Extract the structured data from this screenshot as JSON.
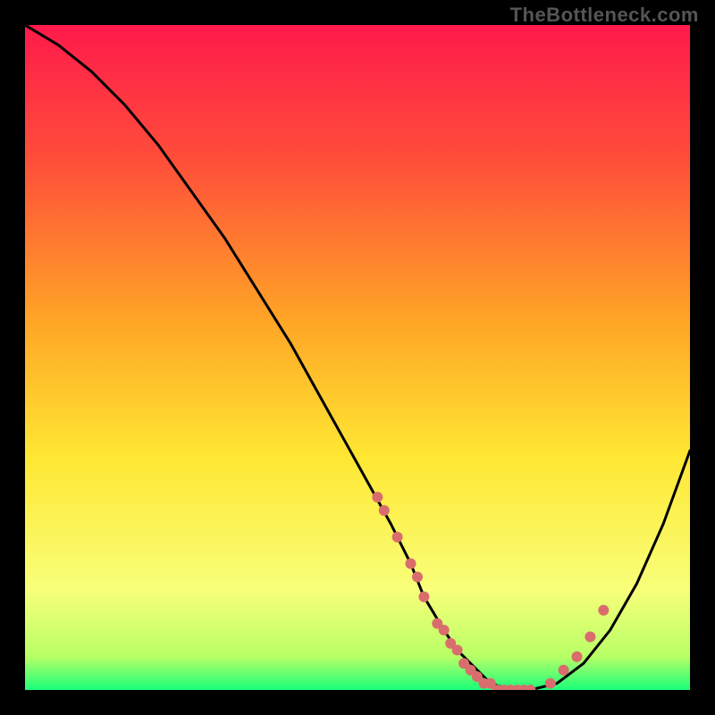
{
  "watermark": "TheBottleneck.com",
  "chart_data": {
    "type": "line",
    "title": "",
    "xlabel": "",
    "ylabel": "",
    "xlim": [
      0,
      100
    ],
    "ylim": [
      0,
      100
    ],
    "gradient_stops": [
      {
        "offset": 0,
        "color": "#ff1a4b"
      },
      {
        "offset": 20,
        "color": "#ff4d3a"
      },
      {
        "offset": 45,
        "color": "#ffa726"
      },
      {
        "offset": 65,
        "color": "#ffe733"
      },
      {
        "offset": 85,
        "color": "#f8ff7a"
      },
      {
        "offset": 95,
        "color": "#b8ff66"
      },
      {
        "offset": 100,
        "color": "#1aff7a"
      }
    ],
    "series": [
      {
        "name": "bottleneck-curve",
        "x": [
          0,
          5,
          10,
          15,
          20,
          25,
          30,
          35,
          40,
          45,
          50,
          55,
          58,
          60,
          63,
          65,
          68,
          70,
          73,
          76,
          80,
          84,
          88,
          92,
          96,
          100
        ],
        "values": [
          100,
          97,
          93,
          88,
          82,
          75,
          68,
          60,
          52,
          43,
          34,
          25,
          19,
          14,
          9,
          6,
          3,
          1,
          0,
          0,
          1,
          4,
          9,
          16,
          25,
          36
        ]
      }
    ],
    "scatter": {
      "name": "sample-points",
      "color": "#d96d6d",
      "x": [
        53,
        54,
        56,
        58,
        59,
        60,
        62,
        63,
        64,
        65,
        66,
        67,
        68,
        69,
        70,
        71,
        72,
        73,
        74,
        75,
        76,
        79,
        81,
        83,
        85,
        87
      ],
      "values": [
        29,
        27,
        23,
        19,
        17,
        14,
        10,
        9,
        7,
        6,
        4,
        3,
        2,
        1,
        1,
        0,
        0,
        0,
        0,
        0,
        0,
        1,
        3,
        5,
        8,
        12
      ]
    }
  }
}
